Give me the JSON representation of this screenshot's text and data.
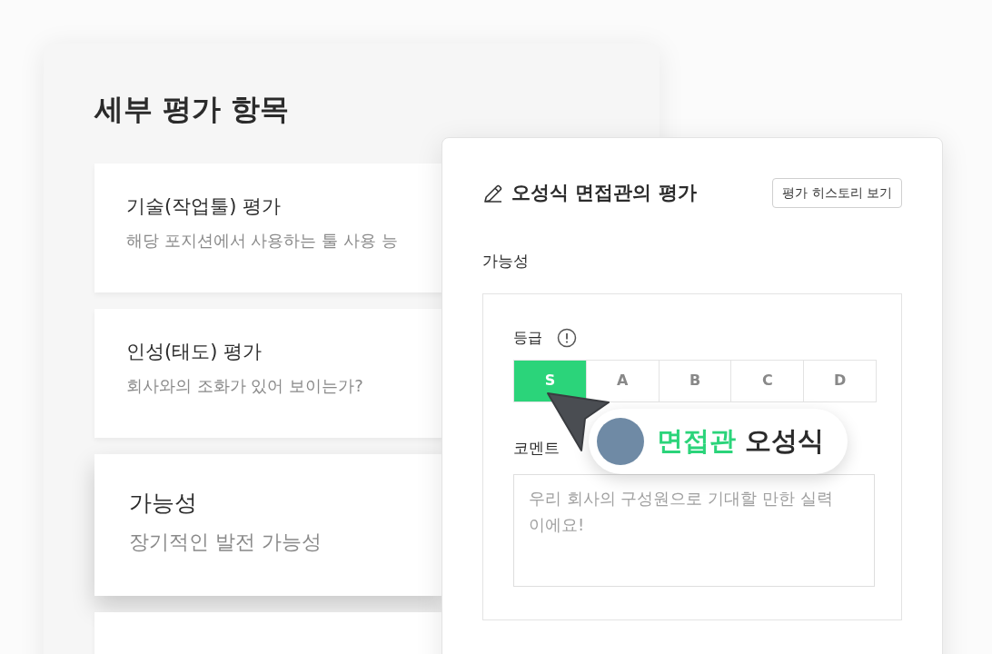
{
  "left_panel": {
    "title": "세부 평가 항목",
    "items": [
      {
        "title": "기술(작업툴) 평가",
        "description": "해당 포지션에서 사용하는 툴 사용 능",
        "selected": false
      },
      {
        "title": "인성(태도) 평가",
        "description": "회사와의 조화가 있어 보이는가?",
        "selected": false
      },
      {
        "title": "가능성",
        "description": "장기적인 발전 가능성",
        "selected": true
      }
    ]
  },
  "evaluation_panel": {
    "title": "오성식 면접관의 평가",
    "history_button": "평가 히스토리 보기",
    "section": "가능성",
    "grade_label": "등급",
    "grades": [
      {
        "label": "S",
        "selected": true
      },
      {
        "label": "A",
        "selected": false
      },
      {
        "label": "B",
        "selected": false
      },
      {
        "label": "C",
        "selected": false
      },
      {
        "label": "D",
        "selected": false
      }
    ],
    "comment_label": "코멘트",
    "comment": "우리 회사의 구성원으로 기대할 만한 실력이에요!"
  },
  "interviewer_tag": {
    "role": "면접관",
    "name": "오성식"
  }
}
